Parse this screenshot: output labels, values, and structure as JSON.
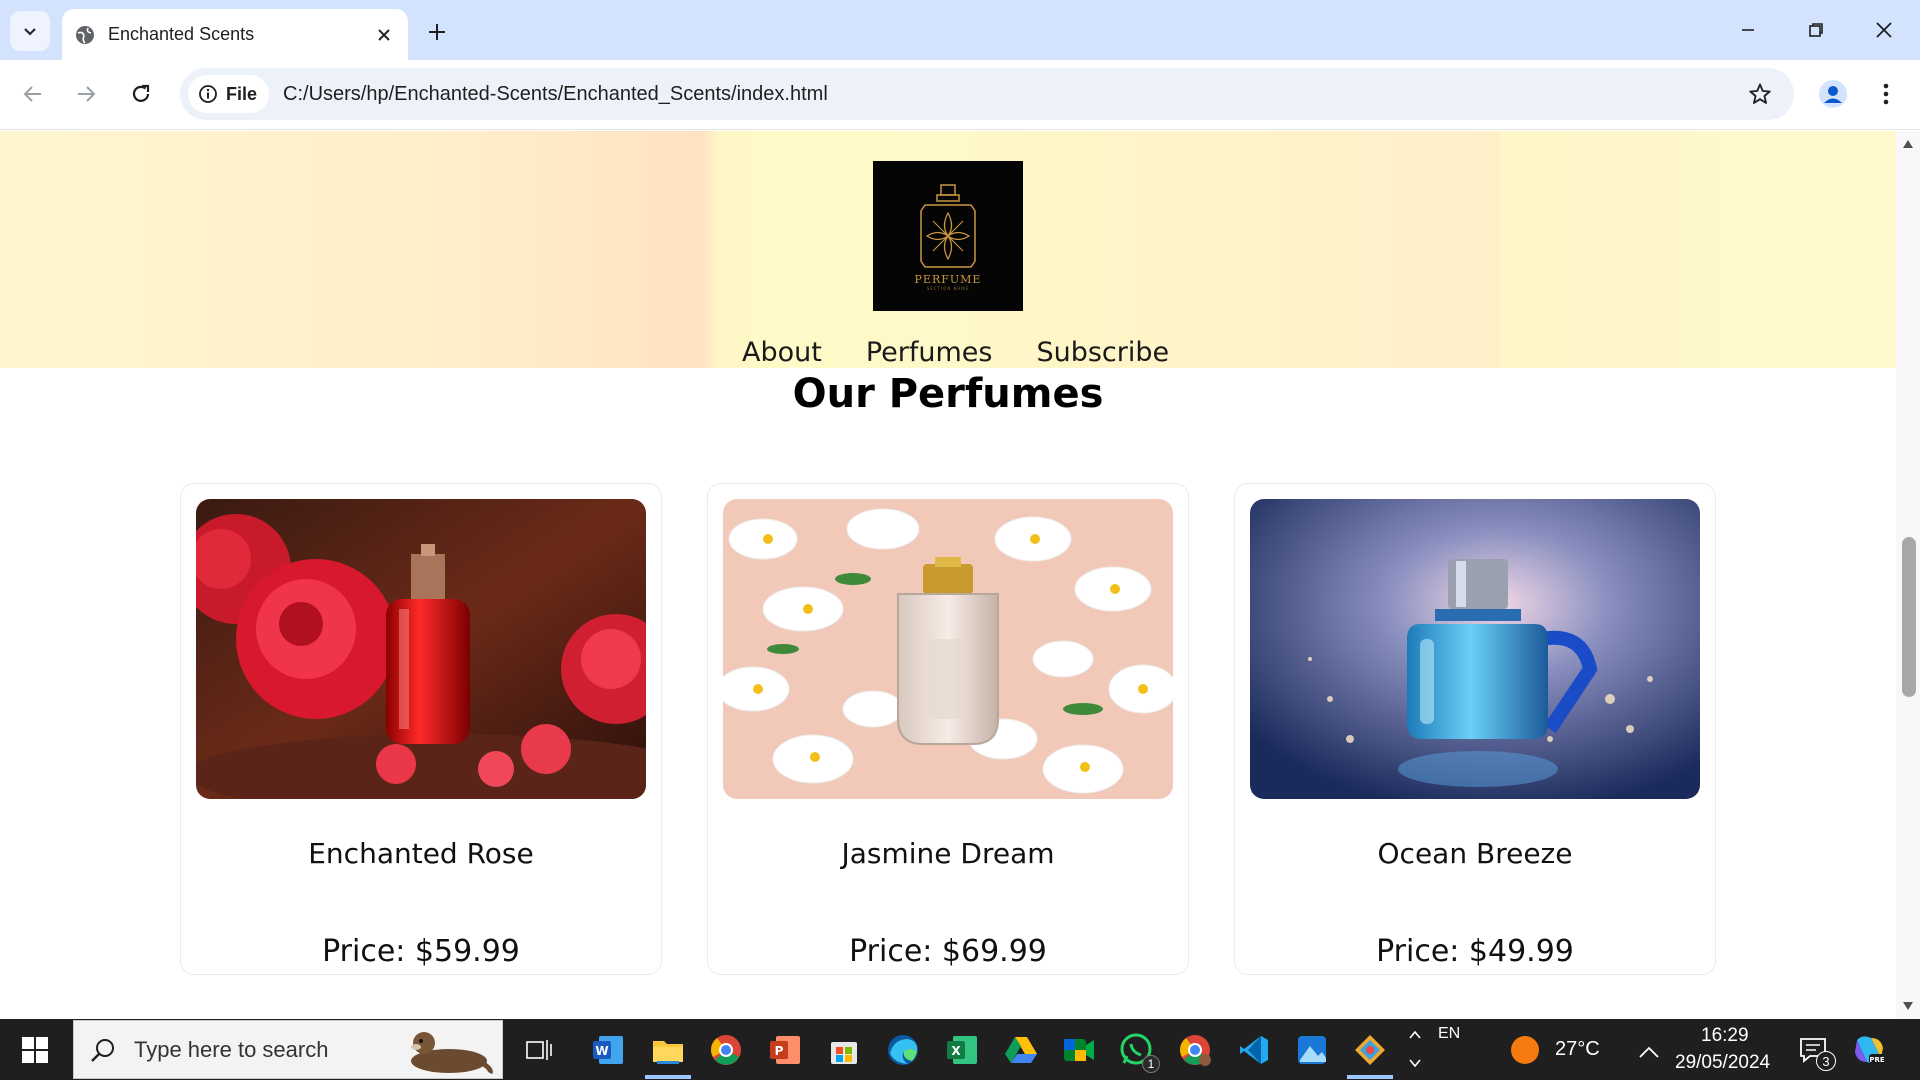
{
  "browser": {
    "tab_title": "Enchanted Scents",
    "url_chip": "File",
    "url": "C:/Users/hp/Enchanted-Scents/Enchanted_Scents/index.html"
  },
  "site": {
    "logo_text": "PERFUME",
    "logo_subtext": "SECTION NAME",
    "nav": [
      "About",
      "Perfumes",
      "Subscribe"
    ],
    "section_title": "Our Perfumes",
    "products": [
      {
        "name": "Enchanted Rose",
        "price": "Price: $59.99"
      },
      {
        "name": "Jasmine Dream",
        "price": "Price: $69.99"
      },
      {
        "name": "Ocean Breeze",
        "price": "Price: $49.99"
      }
    ]
  },
  "taskbar": {
    "search_placeholder": "Type here to search",
    "language": "EN",
    "weather": "27°C",
    "time": "16:29",
    "date": "29/05/2024",
    "notification_count": "3",
    "whatsapp_badge": "1"
  },
  "colors": {
    "tabbar": "#d3e3fd",
    "omnibox": "#edf2fa",
    "logo_gold": "#c8963e",
    "taskbar": "#1f1f1f"
  }
}
